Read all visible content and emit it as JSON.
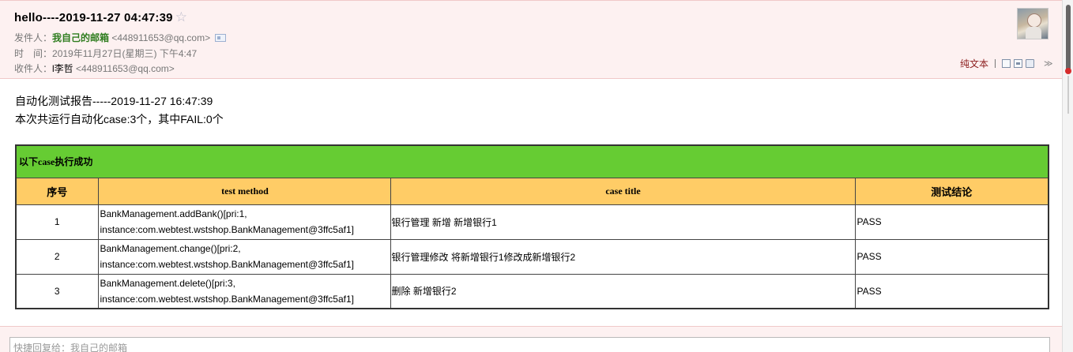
{
  "header": {
    "subject": "hello----2019-11-27 04:47:39",
    "from_label": "发件人：",
    "from_name": "我自己的邮箱",
    "from_email": "<448911653@qq.com>",
    "time_label": "时　间：",
    "time_value": "2019年11月27日(星期三) 下午4:47",
    "to_label": "收件人：",
    "to_name": "l李哲",
    "to_email": "<448911653@qq.com>",
    "plain_text_label": "纯文本"
  },
  "body": {
    "line1": "自动化测试报告-----2019-11-27 16:47:39",
    "line2": "本次共运行自动化case:3个，其中FAIL:0个"
  },
  "table": {
    "banner": "以下case执行成功",
    "headers": [
      "序号",
      "test method",
      "case title",
      "测试结论"
    ],
    "rows": [
      {
        "no": "1",
        "method_a": "BankManagement.addBank()[pri:1,",
        "method_b": "instance:com.webtest.wstshop.BankManagement@3ffc5af1]",
        "title": "银行管理 新增 新增银行1",
        "result": "PASS"
      },
      {
        "no": "2",
        "method_a": "BankManagement.change()[pri:2,",
        "method_b": "instance:com.webtest.wstshop.BankManagement@3ffc5af1]",
        "title": "银行管理修改 将新增银行1修改成新增银行2",
        "result": "PASS"
      },
      {
        "no": "3",
        "method_a": "BankManagement.delete()[pri:3,",
        "method_b": "instance:com.webtest.wstshop.BankManagement@3ffc5af1]",
        "title": "删除 新增银行2",
        "result": "PASS"
      }
    ]
  },
  "reply": {
    "placeholder": "快捷回复给：我自己的邮箱"
  },
  "colors": {
    "banner_green": "#66cc33",
    "header_orange": "#ffcc66",
    "sender_green": "#2f7d1f",
    "header_bg": "#fdf1f1"
  }
}
